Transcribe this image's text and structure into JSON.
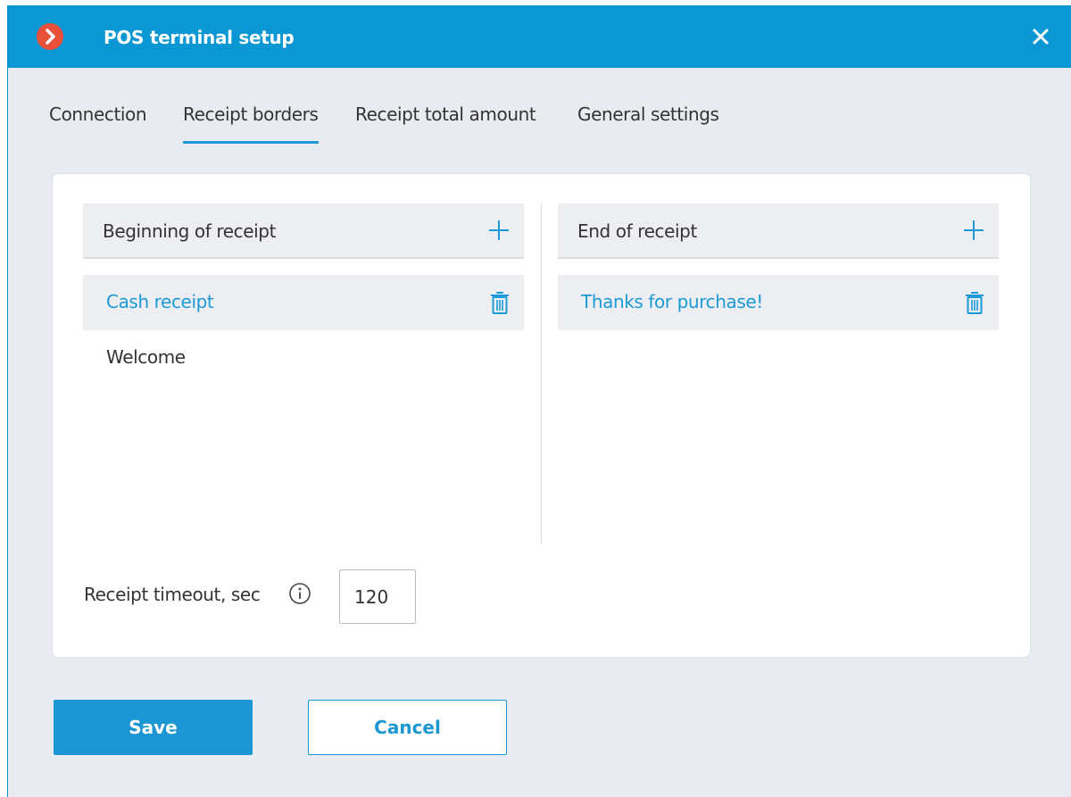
{
  "window": {
    "title": "POS terminal setup",
    "colors": {
      "titlebar": "#0b96d4",
      "accent": "#1c9ad6",
      "logo": "#e8503a"
    }
  },
  "tabs": [
    {
      "label": "Connection",
      "active": false
    },
    {
      "label": "Receipt borders",
      "active": true
    },
    {
      "label": "Receipt total amount",
      "active": false
    },
    {
      "label": "General settings",
      "active": false
    }
  ],
  "beginning": {
    "header": "Beginning of receipt",
    "items": [
      {
        "label": "Cash receipt",
        "selected": true
      },
      {
        "label": "Welcome",
        "selected": false
      }
    ]
  },
  "end": {
    "header": "End of receipt",
    "items": [
      {
        "label": "Thanks for purchase!",
        "selected": true
      }
    ]
  },
  "timeout": {
    "label": "Receipt timeout, sec",
    "value": "120"
  },
  "buttons": {
    "save": "Save",
    "cancel": "Cancel"
  },
  "icons": {
    "logo": "chevron-right-icon",
    "close": "close-icon",
    "add": "plus-icon",
    "delete": "trash-icon",
    "info": "info-icon"
  }
}
